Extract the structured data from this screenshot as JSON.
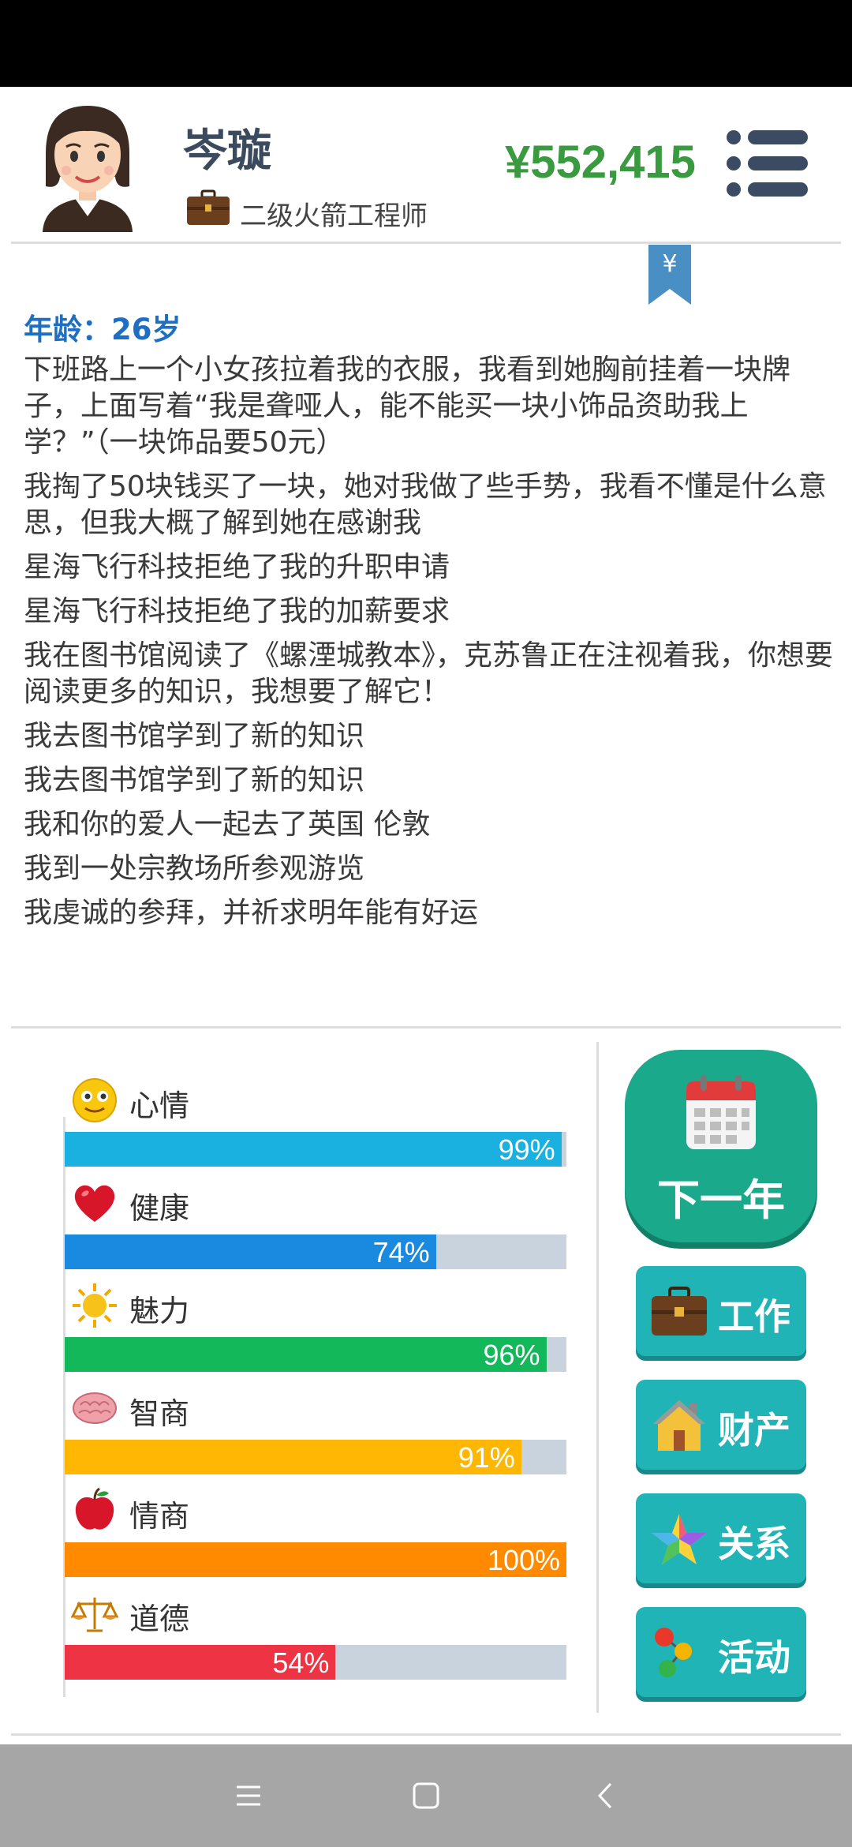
{
  "profile": {
    "name": "岑璇",
    "job": "二级火箭工程师",
    "money": "¥552,415"
  },
  "bookmark_symbol": "¥",
  "log": {
    "age": "年龄：26岁",
    "lines": [
      "下班路上一个小女孩拉着我的衣服，我看到她胸前挂着一块牌子，上面写着“我是聋哑人，能不能买一块小饰品资助我上学？”（一块饰品要50元）",
      "我掏了50块钱买了一块，她对我做了些手势，我看不懂是什么意思，但我大概了解到她在感谢我",
      "星海飞行科技拒绝了我的升职申请",
      "星海飞行科技拒绝了我的加薪要求",
      "我在图书馆阅读了《螺湮城教本》，克苏鲁正在注视着我，你想要阅读更多的知识，我想要了解它！",
      "我去图书馆学到了新的知识",
      "我去图书馆学到了新的知识",
      "我和你的爱人一起去了英国 伦敦",
      "我到一处宗教场所参观游览",
      "我虔诚的参拜，并祈求明年能有好运"
    ]
  },
  "stats": [
    {
      "label": "心情",
      "value": 99,
      "text": "99%",
      "color": "#1ab0e0",
      "icon": "smiley-icon"
    },
    {
      "label": "健康",
      "value": 74,
      "text": "74%",
      "color": "#1a8ae0",
      "icon": "heart-icon"
    },
    {
      "label": "魅力",
      "value": 96,
      "text": "96%",
      "color": "#13b85a",
      "icon": "sun-icon"
    },
    {
      "label": "智商",
      "value": 91,
      "text": "91%",
      "color": "#ffb703",
      "icon": "brain-icon"
    },
    {
      "label": "情商",
      "value": 100,
      "text": "100%",
      "color": "#ff8a00",
      "icon": "apple-icon"
    },
    {
      "label": "道德",
      "value": 54,
      "text": "54%",
      "color": "#ee3344",
      "icon": "scales-icon"
    }
  ],
  "actions": {
    "next_year": "下一年",
    "work": "工作",
    "property": "财产",
    "relations": "关系",
    "activities": "活动"
  }
}
